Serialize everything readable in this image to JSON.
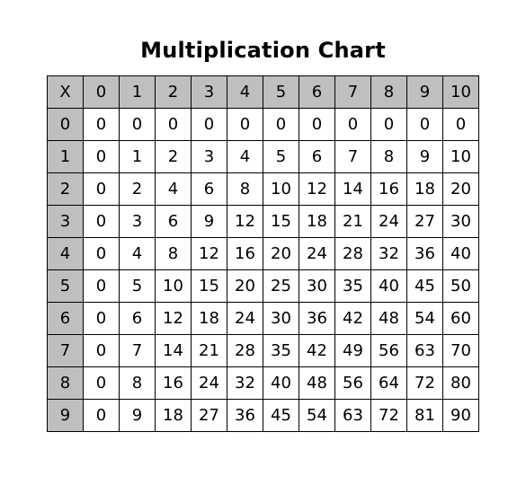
{
  "title": "Multiplication Chart",
  "corner_label": "X",
  "chart_data": {
    "type": "table",
    "title": "Multiplication Chart",
    "col_headers": [
      "0",
      "1",
      "2",
      "3",
      "4",
      "5",
      "6",
      "7",
      "8",
      "9",
      "10"
    ],
    "row_headers": [
      "0",
      "1",
      "2",
      "3",
      "4",
      "5",
      "6",
      "7",
      "8",
      "9"
    ],
    "rows": [
      [
        0,
        0,
        0,
        0,
        0,
        0,
        0,
        0,
        0,
        0,
        0
      ],
      [
        0,
        1,
        2,
        3,
        4,
        5,
        6,
        7,
        8,
        9,
        10
      ],
      [
        0,
        2,
        4,
        6,
        8,
        10,
        12,
        14,
        16,
        18,
        20
      ],
      [
        0,
        3,
        6,
        9,
        12,
        15,
        18,
        21,
        24,
        27,
        30
      ],
      [
        0,
        4,
        8,
        12,
        16,
        20,
        24,
        28,
        32,
        36,
        40
      ],
      [
        0,
        5,
        10,
        15,
        20,
        25,
        30,
        35,
        40,
        45,
        50
      ],
      [
        0,
        6,
        12,
        18,
        24,
        30,
        36,
        42,
        48,
        54,
        60
      ],
      [
        0,
        7,
        14,
        21,
        28,
        35,
        42,
        49,
        56,
        63,
        70
      ],
      [
        0,
        8,
        16,
        24,
        32,
        40,
        48,
        56,
        64,
        72,
        80
      ],
      [
        0,
        9,
        18,
        27,
        36,
        45,
        54,
        63,
        72,
        81,
        90
      ]
    ]
  }
}
